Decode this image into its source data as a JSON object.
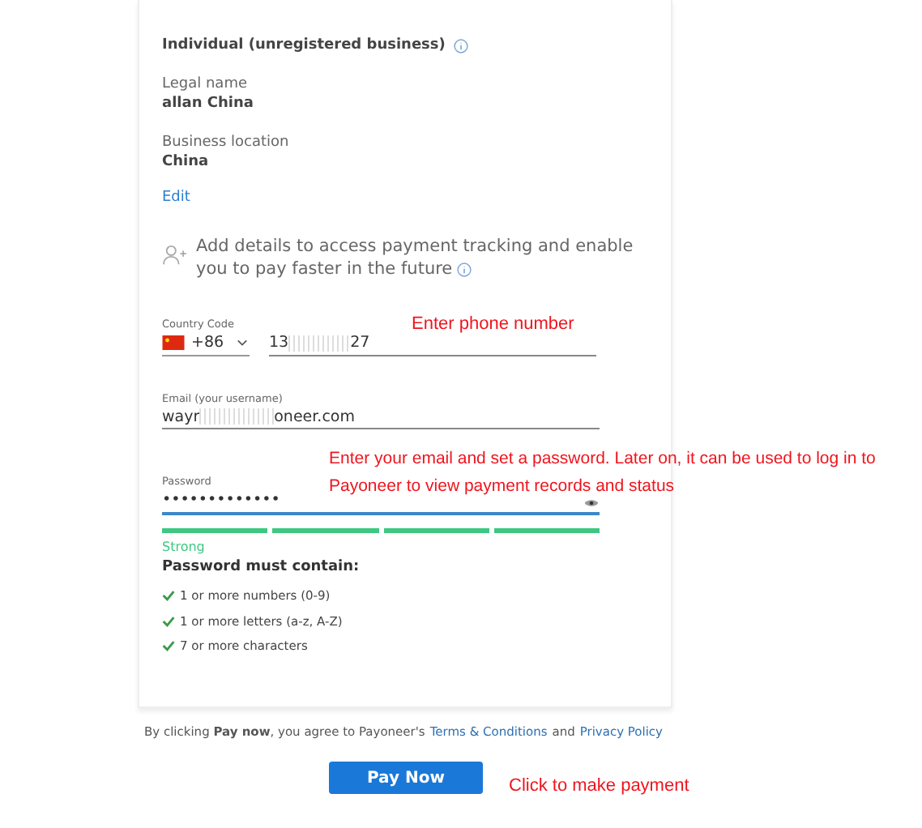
{
  "account": {
    "type": "Individual (unregistered business)",
    "legal_name_label": "Legal name",
    "legal_name": "allan China",
    "location_label": "Business location",
    "location": "China",
    "edit_link": "Edit"
  },
  "promo": "Add details to access payment tracking and enable you to pay faster in the future",
  "phone": {
    "label": "Country Code",
    "code": "+86",
    "value_start": "13",
    "value_end": "27"
  },
  "email": {
    "label": "Email (your username)",
    "value_start": "wayr",
    "value_end": "oneer.com"
  },
  "password": {
    "label": "Password",
    "value": "•••••••••••••",
    "strength": "Strong",
    "level": 1,
    "rules_title": "Password must contain:"
  },
  "rules": [
    {
      "text": "1 or more numbers (0-9)",
      "checked": true
    },
    {
      "text": "1 or more letters (a-z, A-Z)",
      "checked": true
    },
    {
      "text": "7 or more characters",
      "checked": true
    }
  ],
  "consent": "By clicking **Pay now**, you agree to Payoneer's",
  "terms_link": "Terms & Conditions",
  "consent_and": "and",
  "privacy_link": "Privacy Policy",
  "pay_button": "Pay Now",
  "notes": [
    "Enter phone number",
    "Enter your email and set a password. Later on, it can be used to log in to Payoneer to view payment records and status",
    "Click to make payment"
  ]
}
